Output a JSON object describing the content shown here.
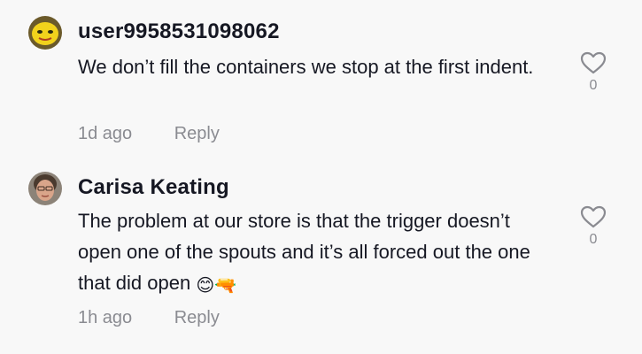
{
  "comments": [
    {
      "username": "user9958531098062",
      "text": "We don’t fill the containers we stop at the first indent.",
      "time": "1d ago",
      "reply_label": "Reply",
      "like_count": "0",
      "avatar_icon": "yellow-smiley-avatar"
    },
    {
      "username": "Carisa Keating",
      "text": "The problem at our store is that the trigger doesn’t open one of the spouts and it’s all forced out the one that did open",
      "emoji": "😊🔫",
      "time": "1h ago",
      "reply_label": "Reply",
      "like_count": "0",
      "avatar_icon": "user-photo-avatar"
    }
  ],
  "colors": {
    "background": "#f8f8f8",
    "text": "#161823",
    "muted": "#8a8b91"
  }
}
